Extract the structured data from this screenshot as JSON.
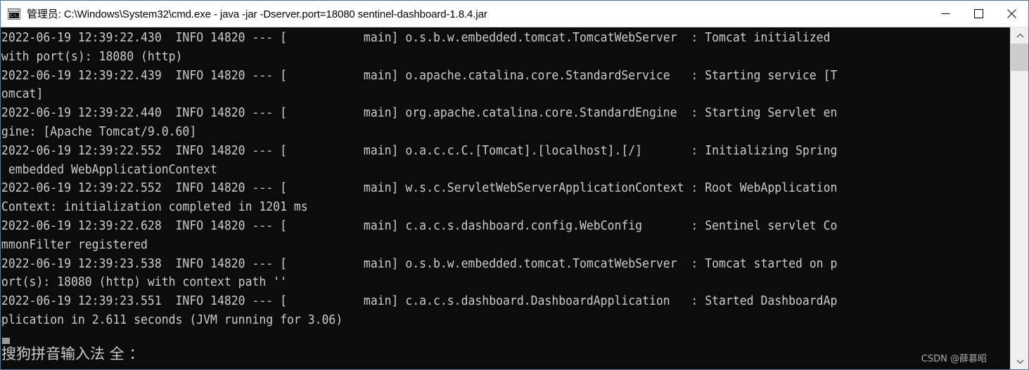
{
  "window": {
    "title": "管理员: C:\\Windows\\System32\\cmd.exe - java  -jar -Dserver.port=18080 sentinel-dashboard-1.8.4.jar",
    "icon_label": "C:\\.",
    "frame_color": "#4a7ba7",
    "titlebar_bg": "#ffffff",
    "console_bg": "#0c0c0c",
    "console_fg": "#cccccc"
  },
  "controls": {
    "minimize": "Minimize",
    "maximize": "Maximize",
    "close": "Close"
  },
  "console": {
    "text": "2022-06-19 12:39:22.430  INFO 14820 --- [           main] o.s.b.w.embedded.tomcat.TomcatWebServer  : Tomcat initialized\nwith port(s): 18080 (http)\n2022-06-19 12:39:22.439  INFO 14820 --- [           main] o.apache.catalina.core.StandardService   : Starting service [T\nomcat]\n2022-06-19 12:39:22.440  INFO 14820 --- [           main] org.apache.catalina.core.StandardEngine  : Starting Servlet en\ngine: [Apache Tomcat/9.0.60]\n2022-06-19 12:39:22.552  INFO 14820 --- [           main] o.a.c.c.C.[Tomcat].[localhost].[/]       : Initializing Spring\n embedded WebApplicationContext\n2022-06-19 12:39:22.552  INFO 14820 --- [           main] w.s.c.ServletWebServerApplicationContext : Root WebApplication\nContext: initialization completed in 1201 ms\n2022-06-19 12:39:22.628  INFO 14820 --- [           main] c.a.c.s.dashboard.config.WebConfig       : Sentinel servlet Co\nmmonFilter registered\n2022-06-19 12:39:23.538  INFO 14820 --- [           main] o.s.b.w.embedded.tomcat.TomcatWebServer  : Tomcat started on p\nort(s): 18080 (http) with context path ''\n2022-06-19 12:39:23.551  INFO 14820 --- [           main] c.a.c.s.dashboard.DashboardApplication   : Started DashboardAp\nplication in 2.611 seconds (JVM running for 3.06)",
    "lines": [
      {
        "timestamp": "2022-06-19 12:39:22.430",
        "level": "INFO",
        "pid": "14820",
        "thread": "main",
        "logger": "o.s.b.w.embedded.tomcat.TomcatWebServer",
        "message": "Tomcat initialized with port(s): 18080 (http)"
      },
      {
        "timestamp": "2022-06-19 12:39:22.439",
        "level": "INFO",
        "pid": "14820",
        "thread": "main",
        "logger": "o.apache.catalina.core.StandardService",
        "message": "Starting service [Tomcat]"
      },
      {
        "timestamp": "2022-06-19 12:39:22.440",
        "level": "INFO",
        "pid": "14820",
        "thread": "main",
        "logger": "org.apache.catalina.core.StandardEngine",
        "message": "Starting Servlet engine: [Apache Tomcat/9.0.60]"
      },
      {
        "timestamp": "2022-06-19 12:39:22.552",
        "level": "INFO",
        "pid": "14820",
        "thread": "main",
        "logger": "o.a.c.c.C.[Tomcat].[localhost].[/]",
        "message": "Initializing Spring embedded WebApplicationContext"
      },
      {
        "timestamp": "2022-06-19 12:39:22.552",
        "level": "INFO",
        "pid": "14820",
        "thread": "main",
        "logger": "w.s.c.ServletWebServerApplicationContext",
        "message": "Root WebApplicationContext: initialization completed in 1201 ms"
      },
      {
        "timestamp": "2022-06-19 12:39:22.628",
        "level": "INFO",
        "pid": "14820",
        "thread": "main",
        "logger": "c.a.c.s.dashboard.config.WebConfig",
        "message": "Sentinel servlet CommonFilter registered"
      },
      {
        "timestamp": "2022-06-19 12:39:23.538",
        "level": "INFO",
        "pid": "14820",
        "thread": "main",
        "logger": "o.s.b.w.embedded.tomcat.TomcatWebServer",
        "message": "Tomcat started on port(s): 18080 (http) with context path ''"
      },
      {
        "timestamp": "2022-06-19 12:39:23.551",
        "level": "INFO",
        "pid": "14820",
        "thread": "main",
        "logger": "c.a.c.s.dashboard.DashboardApplication",
        "message": "Started DashboardApplication in 2.611 seconds (JVM running for 3.06)"
      }
    ]
  },
  "ime": {
    "status": "搜狗拼音输入法 全 ："
  },
  "watermark": {
    "text": "CSDN @薛慕昭"
  },
  "scrollbar": {
    "up_arrow": "▲",
    "down_arrow": "▼"
  }
}
